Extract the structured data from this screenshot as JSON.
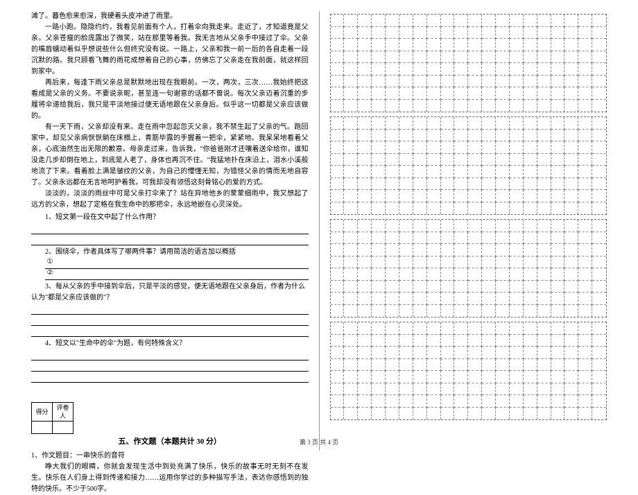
{
  "passage": {
    "p1": "滩了。暮色愈来愈深，我硬着头皮冲进了雨里。",
    "p2": "一路小跑。隐隐约约，我看见前面有个人，打着伞向我走来。走近了，才知道竟是父亲。父亲苍瘦的脸庞露出了微笑，站在那里等着我。我无言地从父亲手中接过了伞。父亲的嘴唇蠕动着似乎想说些什么但终究没有说。一路上，父亲和我一前一后的各自走着一段沉默的路。我只顾看飞舞的雨花成想着自己的心事，仿佛忘了父亲走在我前面，就这样回到家中。",
    "p3": "再后来，每逢下雨父亲总是默默地出现在我眼前。一次，两次，三次……我始终把这看成是父亲的义务。不要说亲昵，甚至连一句谢意的话都不曾说。每次父亲迈着沉重的步履将伞递给我后，我只是平淡地接过便无语地跟在父亲身后。似乎这一切都是父亲应该做的。",
    "p4": "有一天下雨，父亲却没有来。走在雨中忽起忽灭父亲，我不禁生起了父亲的气。跑回家中，却见父亲病恹恹躺在床榻上，青筋毕露的手握着一把伞，紧紧地。我呆呆地看着父亲，心底油然生出无限的歉意。母亲走过来，告诉我，\"你爸爸刚才还嚷着送伞给你，谁知没走几步却倒在地上，到底是人老了，身体也再沉不住。\"我猛地扑在床沿上，泪水小溪般地流了下来。看着脸上满是皱纹的父亲，为自己的懵懂无知，为错怪父亲的情而无地自容了。父亲永远都在无言地呵护着我，可我却没有领悟这刻骨铭心的爱的方式。",
    "p5": "淡淡的，淡淡的雨丝中可是父亲打伞来了？站在异地他乡的蒙蒙细雨中，我又想起了远方的父亲，想起了定格在我生命中的那把伞，永远地嵌在心灵深处。"
  },
  "questions": {
    "q1": "1、短文第一段在文中起了什么作用？",
    "q2_intro": "2、围绕伞，作者具体写了哪两件事？请用简洁的语言加以概括",
    "q2_opt1": "①",
    "q2_opt2": "②",
    "q3": "3、每从父亲的手中接到伞后，只是平淡的感觉，便无语地跟在父亲身后，作者为什么认为\"都是父亲应该做的\"？",
    "q4": "4、短文以\"生命中的伞\"为题，有何特殊含义？"
  },
  "score_table": {
    "h1": "得分",
    "h2": "评卷人"
  },
  "section5": {
    "title": "五、作文题（本题共计 30 分）",
    "prompt_label": "1、作文题目：一串快乐的音符",
    "prompt_body": "睁大我们的眼睛，你就会发现生活中到处充满了快乐，快乐的故事无时无刻不在发生。快乐在人们身上得到传递和接力……运用你学过的多种描写手法，表达你感悟到的独特的快乐。不少于500字。"
  },
  "pager": "第 3 页 共 4 页",
  "chart_data": {
    "type": "table",
    "description": "Essay composition grid for handwritten Chinese characters",
    "blocks": 4,
    "rows_per_block": 8,
    "cols": 20,
    "total_cells": 640
  }
}
